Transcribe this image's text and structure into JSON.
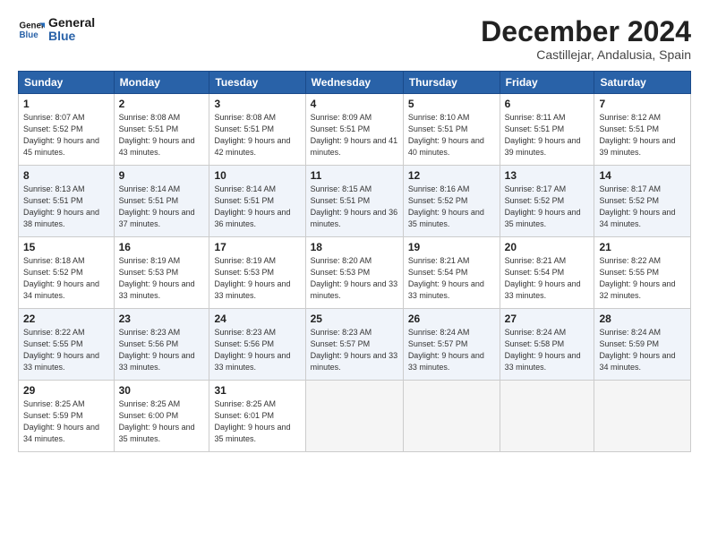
{
  "logo": {
    "line1": "General",
    "line2": "Blue"
  },
  "title": "December 2024",
  "location": "Castillejar, Andalusia, Spain",
  "headers": [
    "Sunday",
    "Monday",
    "Tuesday",
    "Wednesday",
    "Thursday",
    "Friday",
    "Saturday"
  ],
  "weeks": [
    [
      {
        "day": "1",
        "sunrise": "8:07 AM",
        "sunset": "5:52 PM",
        "daylight": "9 hours and 45 minutes."
      },
      {
        "day": "2",
        "sunrise": "8:08 AM",
        "sunset": "5:51 PM",
        "daylight": "9 hours and 43 minutes."
      },
      {
        "day": "3",
        "sunrise": "8:08 AM",
        "sunset": "5:51 PM",
        "daylight": "9 hours and 42 minutes."
      },
      {
        "day": "4",
        "sunrise": "8:09 AM",
        "sunset": "5:51 PM",
        "daylight": "9 hours and 41 minutes."
      },
      {
        "day": "5",
        "sunrise": "8:10 AM",
        "sunset": "5:51 PM",
        "daylight": "9 hours and 40 minutes."
      },
      {
        "day": "6",
        "sunrise": "8:11 AM",
        "sunset": "5:51 PM",
        "daylight": "9 hours and 39 minutes."
      },
      {
        "day": "7",
        "sunrise": "8:12 AM",
        "sunset": "5:51 PM",
        "daylight": "9 hours and 39 minutes."
      }
    ],
    [
      {
        "day": "8",
        "sunrise": "8:13 AM",
        "sunset": "5:51 PM",
        "daylight": "9 hours and 38 minutes."
      },
      {
        "day": "9",
        "sunrise": "8:14 AM",
        "sunset": "5:51 PM",
        "daylight": "9 hours and 37 minutes."
      },
      {
        "day": "10",
        "sunrise": "8:14 AM",
        "sunset": "5:51 PM",
        "daylight": "9 hours and 36 minutes."
      },
      {
        "day": "11",
        "sunrise": "8:15 AM",
        "sunset": "5:51 PM",
        "daylight": "9 hours and 36 minutes."
      },
      {
        "day": "12",
        "sunrise": "8:16 AM",
        "sunset": "5:52 PM",
        "daylight": "9 hours and 35 minutes."
      },
      {
        "day": "13",
        "sunrise": "8:17 AM",
        "sunset": "5:52 PM",
        "daylight": "9 hours and 35 minutes."
      },
      {
        "day": "14",
        "sunrise": "8:17 AM",
        "sunset": "5:52 PM",
        "daylight": "9 hours and 34 minutes."
      }
    ],
    [
      {
        "day": "15",
        "sunrise": "8:18 AM",
        "sunset": "5:52 PM",
        "daylight": "9 hours and 34 minutes."
      },
      {
        "day": "16",
        "sunrise": "8:19 AM",
        "sunset": "5:53 PM",
        "daylight": "9 hours and 33 minutes."
      },
      {
        "day": "17",
        "sunrise": "8:19 AM",
        "sunset": "5:53 PM",
        "daylight": "9 hours and 33 minutes."
      },
      {
        "day": "18",
        "sunrise": "8:20 AM",
        "sunset": "5:53 PM",
        "daylight": "9 hours and 33 minutes."
      },
      {
        "day": "19",
        "sunrise": "8:21 AM",
        "sunset": "5:54 PM",
        "daylight": "9 hours and 33 minutes."
      },
      {
        "day": "20",
        "sunrise": "8:21 AM",
        "sunset": "5:54 PM",
        "daylight": "9 hours and 33 minutes."
      },
      {
        "day": "21",
        "sunrise": "8:22 AM",
        "sunset": "5:55 PM",
        "daylight": "9 hours and 32 minutes."
      }
    ],
    [
      {
        "day": "22",
        "sunrise": "8:22 AM",
        "sunset": "5:55 PM",
        "daylight": "9 hours and 33 minutes."
      },
      {
        "day": "23",
        "sunrise": "8:23 AM",
        "sunset": "5:56 PM",
        "daylight": "9 hours and 33 minutes."
      },
      {
        "day": "24",
        "sunrise": "8:23 AM",
        "sunset": "5:56 PM",
        "daylight": "9 hours and 33 minutes."
      },
      {
        "day": "25",
        "sunrise": "8:23 AM",
        "sunset": "5:57 PM",
        "daylight": "9 hours and 33 minutes."
      },
      {
        "day": "26",
        "sunrise": "8:24 AM",
        "sunset": "5:57 PM",
        "daylight": "9 hours and 33 minutes."
      },
      {
        "day": "27",
        "sunrise": "8:24 AM",
        "sunset": "5:58 PM",
        "daylight": "9 hours and 33 minutes."
      },
      {
        "day": "28",
        "sunrise": "8:24 AM",
        "sunset": "5:59 PM",
        "daylight": "9 hours and 34 minutes."
      }
    ],
    [
      {
        "day": "29",
        "sunrise": "8:25 AM",
        "sunset": "5:59 PM",
        "daylight": "9 hours and 34 minutes."
      },
      {
        "day": "30",
        "sunrise": "8:25 AM",
        "sunset": "6:00 PM",
        "daylight": "9 hours and 35 minutes."
      },
      {
        "day": "31",
        "sunrise": "8:25 AM",
        "sunset": "6:01 PM",
        "daylight": "9 hours and 35 minutes."
      },
      null,
      null,
      null,
      null
    ]
  ]
}
